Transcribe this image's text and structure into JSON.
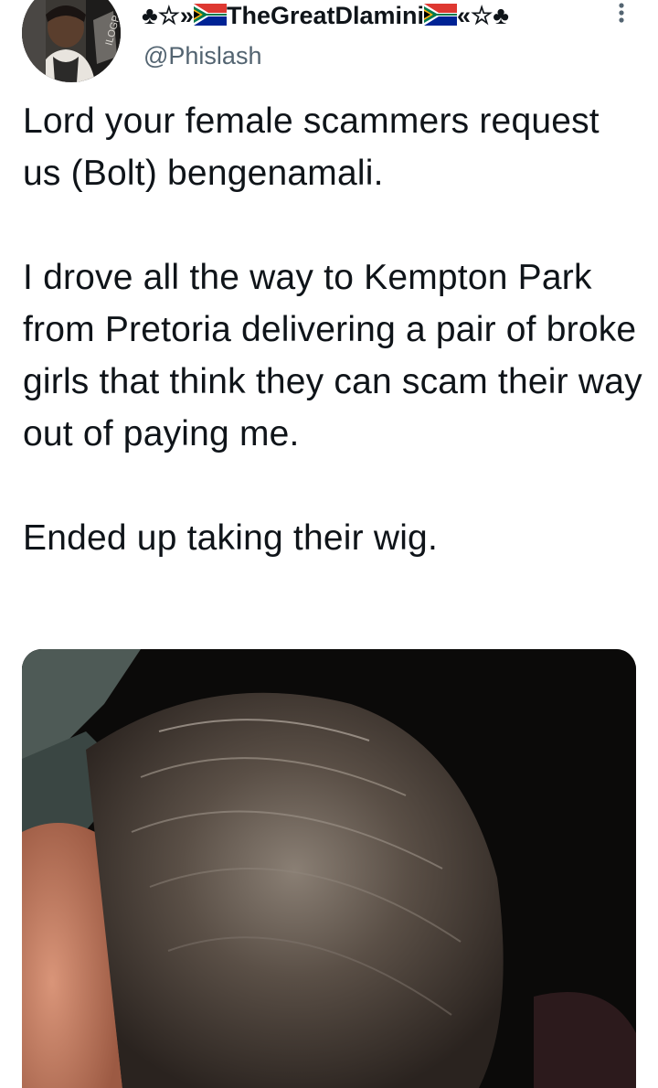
{
  "tweet": {
    "author": {
      "name_prefix": "♣☆»",
      "name_core": "TheGreatDlamini",
      "name_suffix": "«☆♣",
      "flag_icon": "south-africa-flag-icon",
      "handle": "@Phislash",
      "avatar_icon": "profile-photo"
    },
    "more_icon": "more-vertical-icon",
    "paragraphs": [
      "Lord your female scammers request us (Bolt) bengenamali.",
      "I drove all the way to Kempton Park from Pretoria delivering a pair of broke girls that think they can scam their way out of paying me.",
      "Ended up taking their wig."
    ],
    "media": {
      "icon": "photo-of-wig"
    }
  },
  "colors": {
    "text": "#0f1419",
    "secondary": "#536471",
    "background": "#ffffff"
  }
}
